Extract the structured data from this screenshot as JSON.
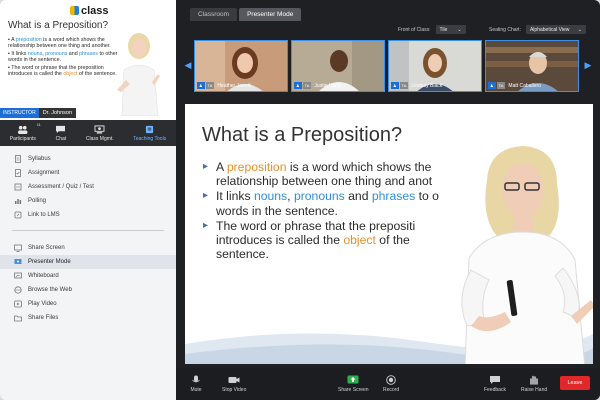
{
  "app": {
    "logo_text": "class"
  },
  "preview": {
    "title": "What is a Preposition?",
    "bullets": [
      [
        "A ",
        "preposition",
        " is a word which shows the relationship between one thing and another."
      ],
      [
        "It links ",
        "nouns",
        ", ",
        "pronouns",
        " and ",
        "phrases",
        " to other words in the sentence."
      ],
      [
        "The word or phrase that the preposition introduces is called the ",
        "object",
        " of the sentence."
      ]
    ],
    "instructor_badge": "INSTRUCTOR",
    "instructor_name": "Dr. Johnson"
  },
  "toolbar": {
    "participants": "Participants",
    "participants_count": "11",
    "chat": "Chat",
    "class_mgmt": "Class Mgmt.",
    "teaching_tools": "Teaching Tools"
  },
  "menu": {
    "group1": [
      "Syllabus",
      "Assignment",
      "Assessment / Quiz / Test",
      "Polling",
      "Link to LMS"
    ],
    "group2": [
      "Share Screen",
      "Presenter Mode",
      "Whiteboard",
      "Browse the Web",
      "Play Video",
      "Share Files"
    ],
    "active": "Presenter Mode"
  },
  "tabs": {
    "classroom": "Classroom",
    "presenter": "Presenter Mode"
  },
  "controls": {
    "front_label": "Front of Class:",
    "front_value": "Tile",
    "seating_label": "Seating Chart:",
    "seating_value": "Alphabetical View"
  },
  "participants": [
    {
      "name": "Heather Jarrett",
      "badge1": "♟",
      "badge2": "TA"
    },
    {
      "name": "Justin Harry",
      "badge1": "♟",
      "badge2": "TA"
    },
    {
      "name": "Lindsay Black",
      "badge1": "♟",
      "badge2": "TA"
    },
    {
      "name": "Matt Caballero",
      "badge1": "♟",
      "badge2": "TA"
    }
  ],
  "slide": {
    "title": "What is a Preposition?",
    "b1": {
      "pre": "A ",
      "kw": "preposition",
      "post1": " is a word which shows the",
      "line2": "relationship between one thing and anot"
    },
    "b2": {
      "pre": "It links ",
      "kw1": "nouns",
      "mid1": ", ",
      "kw2": "pronouns",
      "mid2": " and ",
      "kw3": "phrases",
      "post": " to o",
      "line2": "words in the sentence."
    },
    "b3": {
      "line1": "The word or phrase that the prepositi",
      "pre2": "introduces is called the ",
      "kw": "object",
      "post2": " of the",
      "line3": "sentence."
    }
  },
  "bottom": {
    "mute": "Mute",
    "stop_video": "Stop Video",
    "share_screen": "Share Screen",
    "record": "Record",
    "feedback": "Feedback",
    "raise_hand": "Raise Hand",
    "leave": "Leave"
  },
  "colors": {
    "accent": "#1d6fd6",
    "leave": "#e0282a",
    "keyword_blue": "#2f8fd6",
    "keyword_orange": "#e8902c"
  }
}
